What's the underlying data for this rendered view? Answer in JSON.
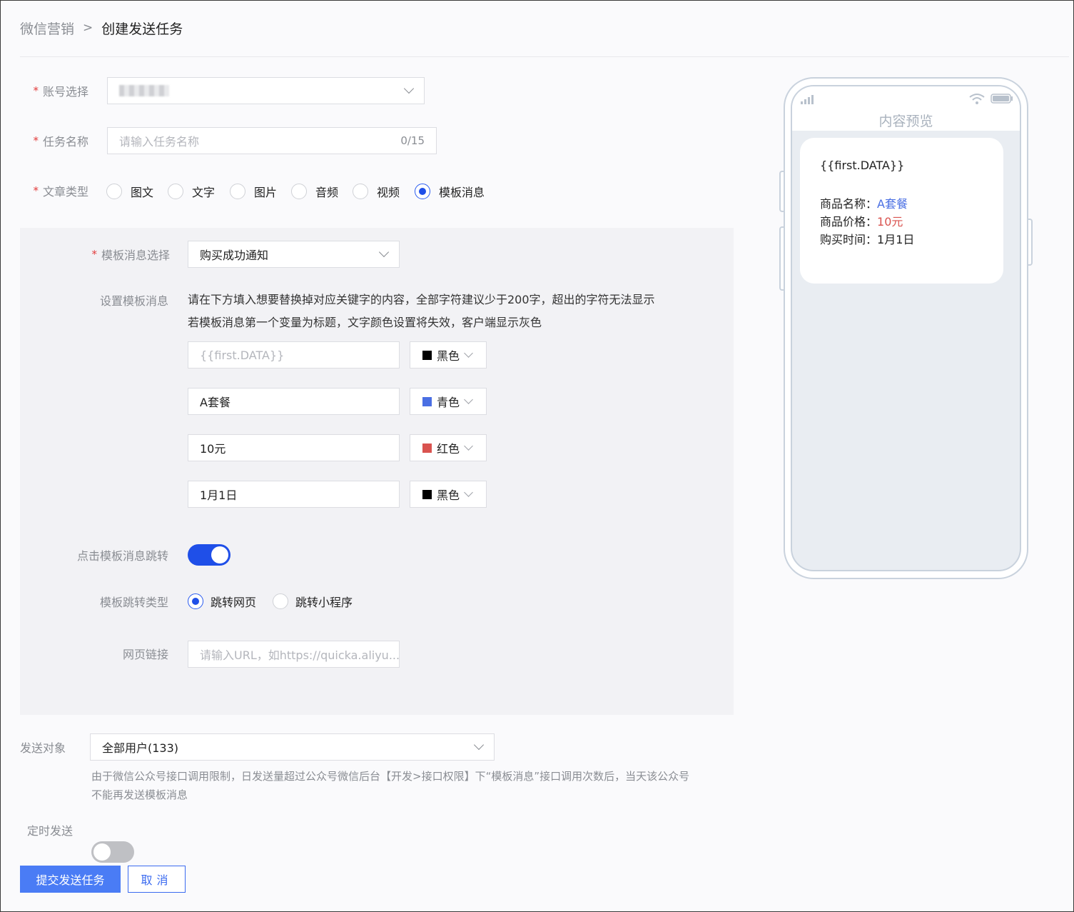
{
  "breadcrumb": {
    "parent": "微信营销",
    "separator": ">",
    "current": "创建发送任务"
  },
  "form": {
    "account": {
      "label": "账号选择"
    },
    "task_name": {
      "label": "任务名称",
      "placeholder": "请输入任务名称",
      "counter": "0/15"
    },
    "article_type": {
      "label": "文章类型",
      "options": [
        "图文",
        "文字",
        "图片",
        "音频",
        "视频",
        "模板消息"
      ],
      "selected": "模板消息"
    }
  },
  "template": {
    "select_label": "模板消息选择",
    "select_value": "购买成功通知",
    "setup_label": "设置模板消息",
    "help_line1": "请在下方填入想要替换掉对应关键字的内容，全部字符建议少于200字，超出的字符无法显示",
    "help_line2": "若模板消息第一个变量为标题，文字颜色设置将失效，客户端显示灰色",
    "fields": [
      {
        "placeholder": "{{first.DATA}}",
        "value": "",
        "color_name": "黑色",
        "color": "#000000"
      },
      {
        "placeholder": "",
        "value": "A套餐",
        "color_name": "青色",
        "color": "#4a6fe3"
      },
      {
        "placeholder": "",
        "value": "10元",
        "color_name": "红色",
        "color": "#d9534f"
      },
      {
        "placeholder": "",
        "value": "1月1日",
        "color_name": "黑色",
        "color": "#000000"
      }
    ],
    "jump_label": "点击模板消息跳转",
    "jump_enabled": true,
    "jump_type_label": "模板跳转类型",
    "jump_types": [
      "跳转网页",
      "跳转小程序"
    ],
    "jump_type_selected": "跳转网页",
    "url_label": "网页链接",
    "url_placeholder": "请输入URL，如https://quicka.aliyu..."
  },
  "send": {
    "target_label": "发送对象",
    "target_value": "全部用户(133)",
    "note_line1": "由于微信公众号接口调用限制，日发送量超过公众号微信后台【开发>接口权限】下“模板消息”接口调用次数后，当天该公众号",
    "note_line2": "不能再发送模板消息",
    "schedule_label": "定时发送",
    "schedule_enabled": false
  },
  "actions": {
    "submit": "提交发送任务",
    "cancel": "取消"
  },
  "preview": {
    "title": "内容预览",
    "first": "{{first.DATA}}",
    "rows": [
      {
        "key": "商品名称：",
        "value": "A套餐",
        "color": "#4a6fe3"
      },
      {
        "key": "商品价格：",
        "value": "10元",
        "color": "#d9534f"
      },
      {
        "key": "购买时间：",
        "value": "1月1日",
        "color": "#222222"
      }
    ]
  }
}
